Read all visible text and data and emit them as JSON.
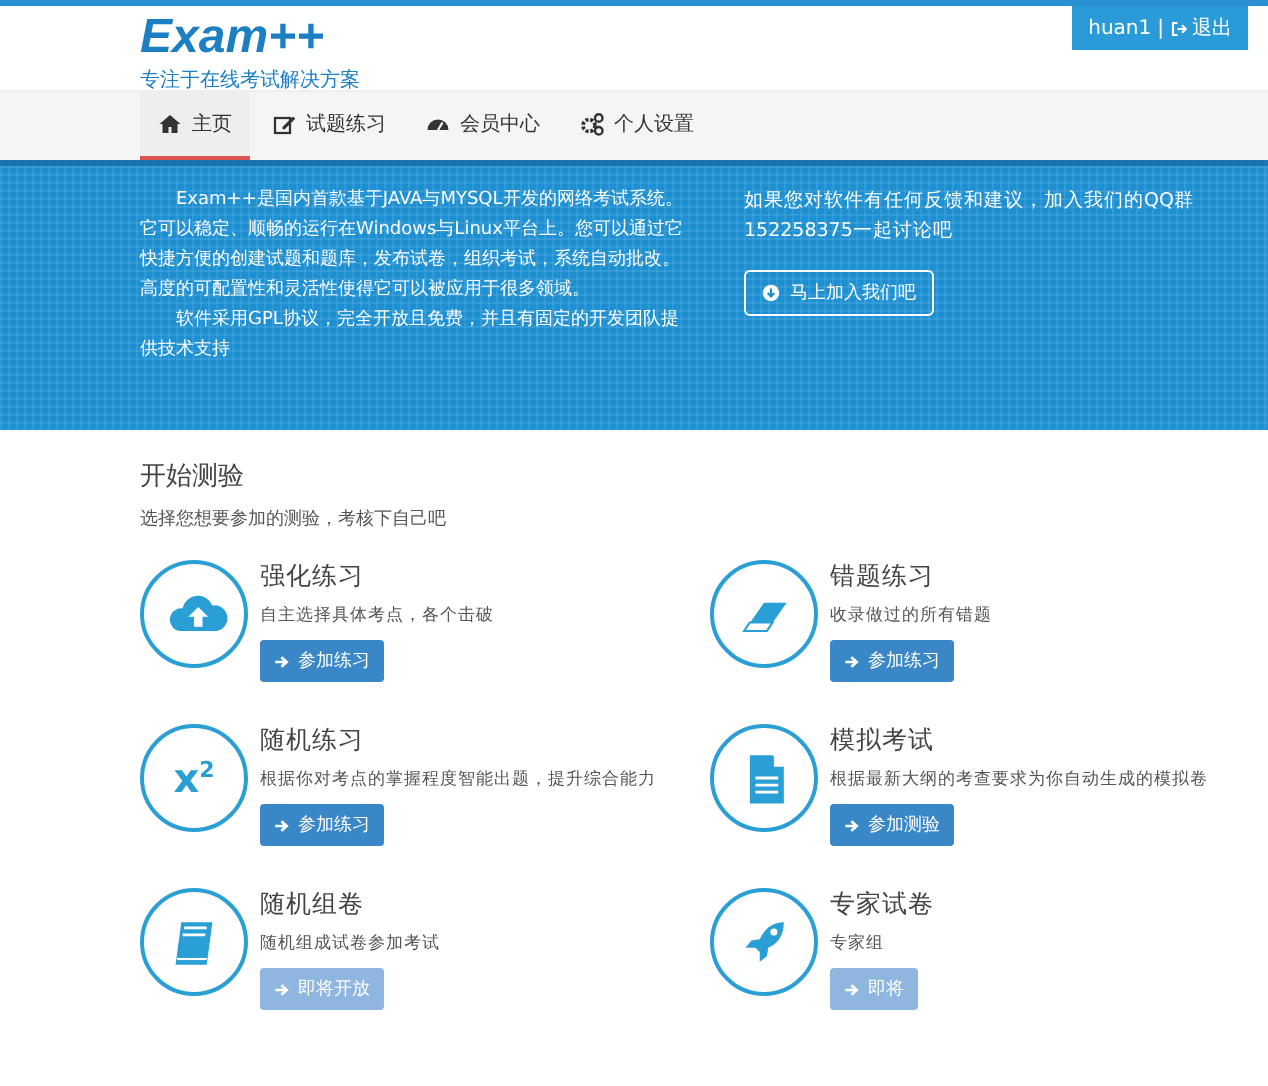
{
  "logo": {
    "title": "Exam++",
    "subtitle": "专注于在线考试解决方案"
  },
  "user": {
    "name": "huan1",
    "separator": "|",
    "logout": "退出"
  },
  "nav": [
    {
      "label": "主页",
      "selected": true
    },
    {
      "label": "试题练习",
      "selected": false
    },
    {
      "label": "会员中心",
      "selected": false
    },
    {
      "label": "个人设置",
      "selected": false
    }
  ],
  "banner": {
    "paragraphs": [
      "Exam++是国内首款基于JAVA与MYSQL开发的网络考试系统。它可以稳定、顺畅的运行在Windows与Linux平台上。您可以通过它快捷方便的创建试题和题库，发布试卷，组织考试，系统自动批改。高度的可配置性和灵活性使得它可以被应用于很多领域。",
      "软件采用GPL协议，完全开放且免费，并且有固定的开发团队提供技术支持"
    ],
    "contact": "如果您对软件有任何反馈和建议，加入我们的QQ群152258375一起讨论吧",
    "join_button": "马上加入我们吧"
  },
  "section": {
    "title": "开始测验",
    "subtitle": "选择您想要参加的测验，考核下自己吧"
  },
  "cards": [
    {
      "title": "强化练习",
      "desc": "自主选择具体考点，各个击破",
      "button": "参加练习",
      "disabled": false
    },
    {
      "title": "错题练习",
      "desc": "收录做过的所有错题",
      "button": "参加练习",
      "disabled": false
    },
    {
      "icon_text": "x$^{2}$",
      "title": "随机练习",
      "desc": "根据你对考点的掌握程度智能出题，提升综合能力",
      "button": "参加练习",
      "disabled": false
    },
    {
      "title": "模拟考试",
      "desc": "根据最新大纲的考查要求为你自动生成的模拟卷",
      "button": "参加测验",
      "disabled": false
    },
    {
      "title": "随机组卷",
      "desc": "随机组成试卷参加考试",
      "button": "即将开放",
      "disabled": true
    },
    {
      "title": "专家试卷",
      "desc": "专家组",
      "button": "即将",
      "disabled": true
    }
  ]
}
